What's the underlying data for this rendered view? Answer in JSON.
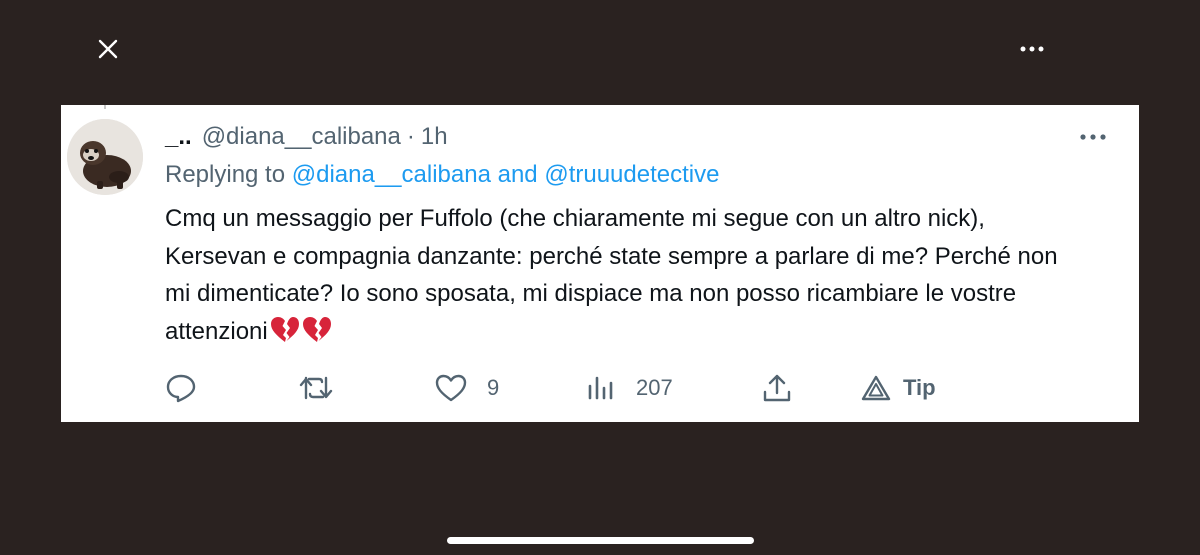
{
  "tweet": {
    "display_name": "_..",
    "handle": "@diana__calibana",
    "separator": "·",
    "time": "1h",
    "replying_prefix": "Replying to",
    "replying_to_1": "@diana__calibana",
    "replying_and": "and",
    "replying_to_2": "@truuudetective",
    "text": "Cmq un messaggio per Fuffolo (che chiaramente mi segue con un altro nick), Kersevan e compagnia danzante: perché state sempre a parlare di me? Perché non mi dimenticate? Io sono sposata, mi dispiace ma non posso ricambiare le vostre attenzioni",
    "emojis": [
      "broken-heart-emoji",
      "broken-heart-emoji"
    ]
  },
  "actions": {
    "reply_count": "",
    "retweet_count": "",
    "like_count": "9",
    "views_count": "207",
    "tip_label": "Tip"
  },
  "icons": {
    "close": "close-icon",
    "more": "more-icon",
    "reply": "reply-icon",
    "retweet": "retweet-icon",
    "like": "heart-icon",
    "views": "views-icon",
    "share": "share-icon",
    "tip": "tip-icon"
  },
  "colors": {
    "background": "#2a2220",
    "card": "#ffffff",
    "mention": "#1d9bf0",
    "secondary_text": "#536471",
    "primary_text": "#0f1419"
  }
}
